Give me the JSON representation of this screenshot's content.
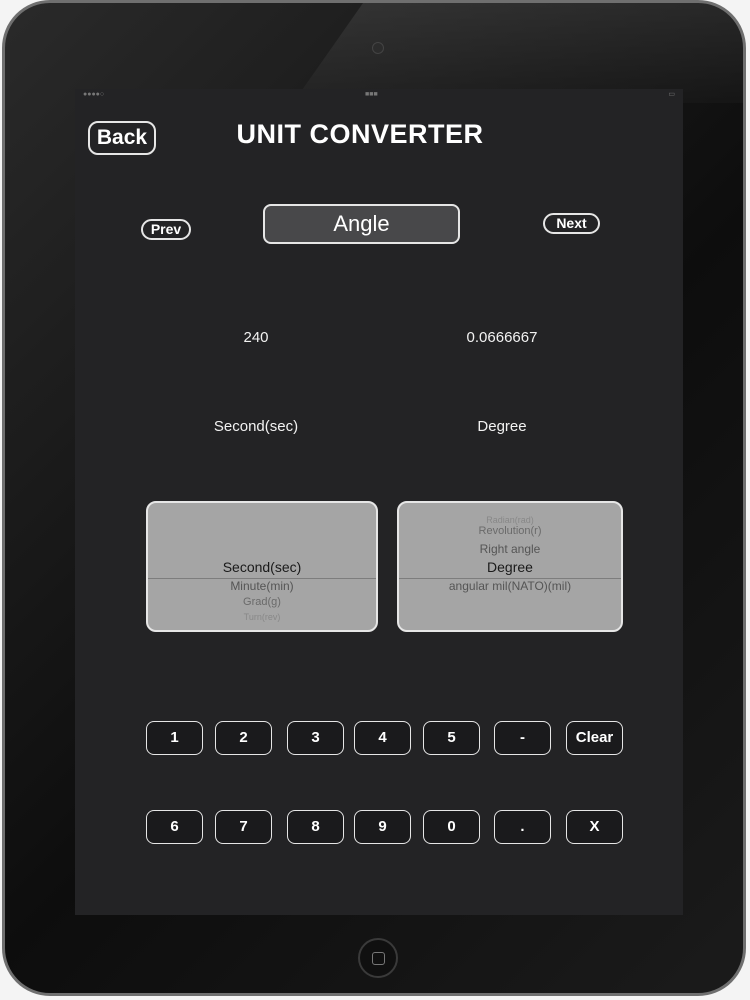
{
  "header": {
    "back_label": "Back",
    "title": "UNIT CONVERTER"
  },
  "category": {
    "prev_label": "Prev",
    "name": "Angle",
    "next_label": "Next"
  },
  "conversion": {
    "input_value": "240",
    "output_value": "0.0666667",
    "from_unit": "Second(sec)",
    "to_unit": "Degree"
  },
  "from_picker": {
    "selected": "Second(sec)",
    "below": [
      "Minute(min)",
      "Grad(g)",
      "Turn(rev)"
    ]
  },
  "to_picker": {
    "above": [
      "Radian(rad)",
      "Revolution(r)",
      "Right angle"
    ],
    "selected": "Degree",
    "below": [
      "angular mil(NATO)(mil)"
    ]
  },
  "keypad": {
    "row1": [
      "1",
      "2",
      "3",
      "4",
      "5",
      "-",
      "Clear"
    ],
    "row2": [
      "6",
      "7",
      "8",
      "9",
      "0",
      ".",
      "X"
    ]
  },
  "colors": {
    "screen_background": "#232325",
    "picker_background": "#a5a5a5",
    "button_border": "#e6e6e6",
    "text": "#ffffff"
  }
}
